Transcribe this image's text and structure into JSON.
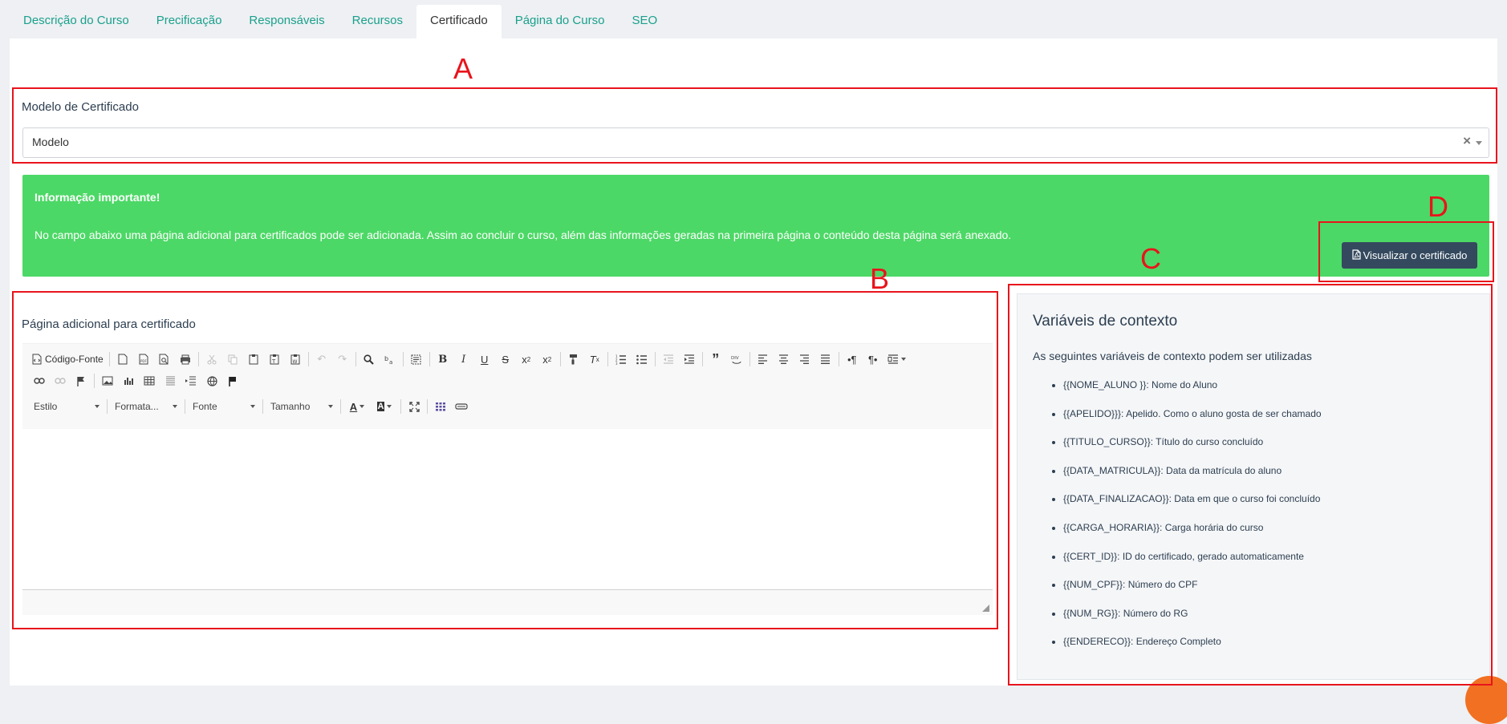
{
  "tabs": [
    {
      "label": "Descrição do Curso",
      "active": false
    },
    {
      "label": "Precificação",
      "active": false
    },
    {
      "label": "Responsáveis",
      "active": false
    },
    {
      "label": "Recursos",
      "active": false
    },
    {
      "label": "Certificado",
      "active": true
    },
    {
      "label": "Página do Curso",
      "active": false
    },
    {
      "label": "SEO",
      "active": false
    }
  ],
  "annotations": {
    "a": "A",
    "b": "B",
    "c": "C",
    "d": "D"
  },
  "certificate_model": {
    "label": "Modelo de Certificado",
    "selected": "Modelo",
    "clear_symbol": "×"
  },
  "alert": {
    "title": "Informação importante!",
    "message": "No campo abaixo uma página adicional para certificados pode ser adicionada. Assim ao concluir o curso, além das informações geradas na primeira página o conteúdo desta página será anexado."
  },
  "preview_button": {
    "label": "Visualizar o certificado",
    "icon": "file-pdf-icon"
  },
  "editor": {
    "label": "Página adicional para certificado",
    "source_label": "Código-Fonte",
    "combos": {
      "style": "Estilo",
      "format": "Formata...",
      "font": "Fonte",
      "size": "Tamanho"
    }
  },
  "variables": {
    "title": "Variáveis de contexto",
    "intro": "As seguintes variáveis de contexto podem ser utilizadas",
    "items": [
      "{{NOME_ALUNO }}: Nome do Aluno",
      "{{APELIDO}}}: Apelido. Como o aluno gosta de ser chamado",
      "{{TITULO_CURSO}}: Título do curso concluído",
      "{{DATA_MATRICULA}}: Data da matrícula do aluno",
      "{{DATA_FINALIZACAO}}: Data em que o curso foi concluído",
      "{{CARGA_HORARIA}}: Carga horária do curso",
      "{{CERT_ID}}: ID do certificado, gerado automaticamente",
      "{{NUM_CPF}}: Número do CPF",
      "{{NUM_RG}}: Número do RG",
      "{{ENDERECO}}: Endereço Completo"
    ]
  },
  "colors": {
    "accent": "#1aa08c",
    "alert_bg": "#4cd866",
    "button_bg": "#34495e",
    "annotation": "#e8141c"
  }
}
